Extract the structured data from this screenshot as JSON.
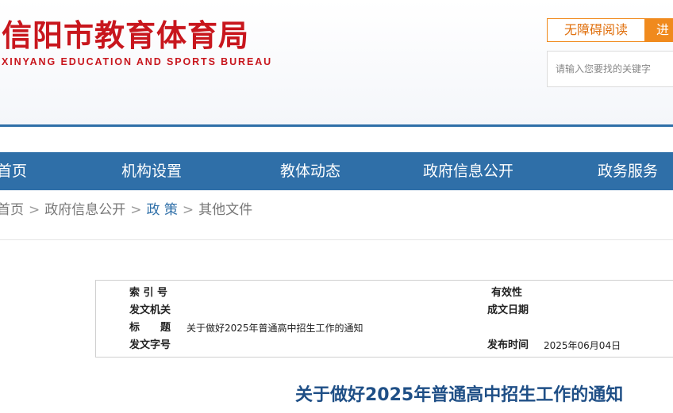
{
  "header": {
    "logo_cn": "信阳市教育体育局",
    "logo_en": "XINYANG EDUCATION AND SPORTS BUREAU",
    "accessibility_label": "无障碍阅读",
    "enter_label": "进",
    "search_placeholder": "请输入您要找的关键字"
  },
  "nav": {
    "items": [
      {
        "label": "首页"
      },
      {
        "label": "机构设置"
      },
      {
        "label": "教体动态"
      },
      {
        "label": "政府信息公开"
      },
      {
        "label": "政务服务"
      }
    ]
  },
  "breadcrumb": {
    "items": [
      "首页",
      "政府信息公开",
      "政 策",
      "其他文件"
    ],
    "separator": ">"
  },
  "meta": {
    "index_label": "索 引 号",
    "index_value": "",
    "validity_label": "有效性",
    "validity_value": "",
    "issuer_label": "发文机关",
    "issuer_value": "",
    "created_label": "成文日期",
    "created_value": "",
    "title_label": "标　　题",
    "title_value": "关于做好2025年普通高中招生工作的通知",
    "docno_label": "发文字号",
    "docno_value": "",
    "published_label": "发布时间",
    "published_value": "2025年06月04日"
  },
  "article": {
    "title": "关于做好2025年普通高中招生工作的通知"
  },
  "colors": {
    "brand_red": "#c8161d",
    "nav_blue": "#2f6fa8",
    "accent_orange": "#f08a1d",
    "title_blue": "#1f4f86"
  }
}
